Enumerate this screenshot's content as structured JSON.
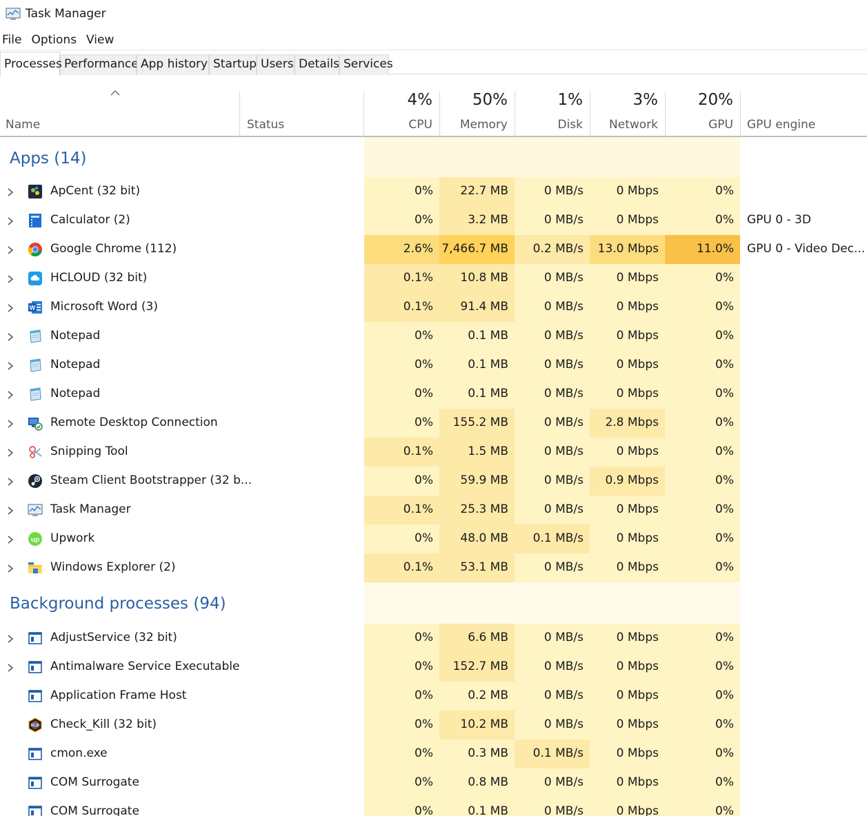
{
  "window": {
    "title": "Task Manager"
  },
  "menu": [
    "File",
    "Options",
    "View"
  ],
  "tabs": [
    "Processes",
    "Performance",
    "App history",
    "Startup",
    "Users",
    "Details",
    "Services"
  ],
  "columns": {
    "name": "Name",
    "status": "Status",
    "cpu": {
      "pct": "4%",
      "label": "CPU"
    },
    "memory": {
      "pct": "50%",
      "label": "Memory"
    },
    "disk": {
      "pct": "1%",
      "label": "Disk"
    },
    "network": {
      "pct": "3%",
      "label": "Network"
    },
    "gpu": {
      "pct": "20%",
      "label": "GPU"
    },
    "gpu_engine": "GPU engine"
  },
  "groups": {
    "apps": "Apps (14)",
    "background": "Background processes (94)"
  },
  "apps": [
    {
      "name": "ApCent (32 bit)",
      "icon": "apcent-icon",
      "cpu": "0%",
      "memory": "22.7 MB",
      "disk": "0 MB/s",
      "network": "0 Mbps",
      "gpu": "0%",
      "gpu_engine": ""
    },
    {
      "name": "Calculator (2)",
      "icon": "calculator-icon",
      "cpu": "0%",
      "memory": "3.2 MB",
      "disk": "0 MB/s",
      "network": "0 Mbps",
      "gpu": "0%",
      "gpu_engine": "GPU 0 - 3D"
    },
    {
      "name": "Google Chrome (112)",
      "icon": "chrome-icon",
      "cpu": "2.6%",
      "memory": "7,466.7 MB",
      "disk": "0.2 MB/s",
      "network": "13.0 Mbps",
      "gpu": "11.0%",
      "gpu_engine": "GPU 0 - Video Dec..."
    },
    {
      "name": "HCLOUD (32 bit)",
      "icon": "hcloud-icon",
      "cpu": "0.1%",
      "memory": "10.8 MB",
      "disk": "0 MB/s",
      "network": "0 Mbps",
      "gpu": "0%",
      "gpu_engine": ""
    },
    {
      "name": "Microsoft Word (3)",
      "icon": "word-icon",
      "cpu": "0.1%",
      "memory": "91.4 MB",
      "disk": "0 MB/s",
      "network": "0 Mbps",
      "gpu": "0%",
      "gpu_engine": ""
    },
    {
      "name": "Notepad",
      "icon": "notepad-icon",
      "cpu": "0%",
      "memory": "0.1 MB",
      "disk": "0 MB/s",
      "network": "0 Mbps",
      "gpu": "0%",
      "gpu_engine": ""
    },
    {
      "name": "Notepad",
      "icon": "notepad-icon",
      "cpu": "0%",
      "memory": "0.1 MB",
      "disk": "0 MB/s",
      "network": "0 Mbps",
      "gpu": "0%",
      "gpu_engine": ""
    },
    {
      "name": "Notepad",
      "icon": "notepad-icon",
      "cpu": "0%",
      "memory": "0.1 MB",
      "disk": "0 MB/s",
      "network": "0 Mbps",
      "gpu": "0%",
      "gpu_engine": ""
    },
    {
      "name": "Remote Desktop Connection",
      "icon": "remote-desktop-icon",
      "cpu": "0%",
      "memory": "155.2 MB",
      "disk": "0 MB/s",
      "network": "2.8 Mbps",
      "gpu": "0%",
      "gpu_engine": ""
    },
    {
      "name": "Snipping Tool",
      "icon": "snipping-tool-icon",
      "cpu": "0.1%",
      "memory": "1.5 MB",
      "disk": "0 MB/s",
      "network": "0 Mbps",
      "gpu": "0%",
      "gpu_engine": ""
    },
    {
      "name": "Steam Client Bootstrapper (32 b...",
      "icon": "steam-icon",
      "cpu": "0%",
      "memory": "59.9 MB",
      "disk": "0 MB/s",
      "network": "0.9 Mbps",
      "gpu": "0%",
      "gpu_engine": ""
    },
    {
      "name": "Task Manager",
      "icon": "task-manager-icon",
      "cpu": "0.1%",
      "memory": "25.3 MB",
      "disk": "0 MB/s",
      "network": "0 Mbps",
      "gpu": "0%",
      "gpu_engine": ""
    },
    {
      "name": "Upwork",
      "icon": "upwork-icon",
      "cpu": "0%",
      "memory": "48.0 MB",
      "disk": "0.1 MB/s",
      "network": "0 Mbps",
      "gpu": "0%",
      "gpu_engine": ""
    },
    {
      "name": "Windows Explorer (2)",
      "icon": "file-explorer-icon",
      "cpu": "0.1%",
      "memory": "53.1 MB",
      "disk": "0 MB/s",
      "network": "0 Mbps",
      "gpu": "0%",
      "gpu_engine": ""
    }
  ],
  "background": [
    {
      "name": "AdjustService (32 bit)",
      "icon": "service-window-icon",
      "expand": true,
      "cpu": "0%",
      "memory": "6.6 MB",
      "disk": "0 MB/s",
      "network": "0 Mbps",
      "gpu": "0%"
    },
    {
      "name": "Antimalware Service Executable",
      "icon": "service-window-icon",
      "expand": true,
      "cpu": "0%",
      "memory": "152.7 MB",
      "disk": "0 MB/s",
      "network": "0 Mbps",
      "gpu": "0%"
    },
    {
      "name": "Application Frame Host",
      "icon": "service-window-icon",
      "expand": false,
      "cpu": "0%",
      "memory": "0.2 MB",
      "disk": "0 MB/s",
      "network": "0 Mbps",
      "gpu": "0%"
    },
    {
      "name": "Check_Kill (32 bit)",
      "icon": "rgb-fusion-icon",
      "expand": false,
      "cpu": "0%",
      "memory": "10.2 MB",
      "disk": "0 MB/s",
      "network": "0 Mbps",
      "gpu": "0%"
    },
    {
      "name": "cmon.exe",
      "icon": "service-window-icon",
      "expand": false,
      "cpu": "0%",
      "memory": "0.3 MB",
      "disk": "0.1 MB/s",
      "network": "0 Mbps",
      "gpu": "0%"
    },
    {
      "name": "COM Surrogate",
      "icon": "service-window-icon",
      "expand": false,
      "cpu": "0%",
      "memory": "0.8 MB",
      "disk": "0 MB/s",
      "network": "0 Mbps",
      "gpu": "0%"
    },
    {
      "name": "COM Surrogate",
      "icon": "service-window-icon",
      "expand": false,
      "cpu": "0%",
      "memory": "0.1 MB",
      "disk": "0 MB/s",
      "network": "0 Mbps",
      "gpu": "0%"
    }
  ],
  "colors": {
    "group_title": "#2a5fa6",
    "heat_light": "#fff4c4",
    "heat_medium": "#fde9a8",
    "heat_strong": "#fcdd7e",
    "heat_memory_high": "#ffd25a",
    "heat_gpu_high": "#f9c148"
  }
}
